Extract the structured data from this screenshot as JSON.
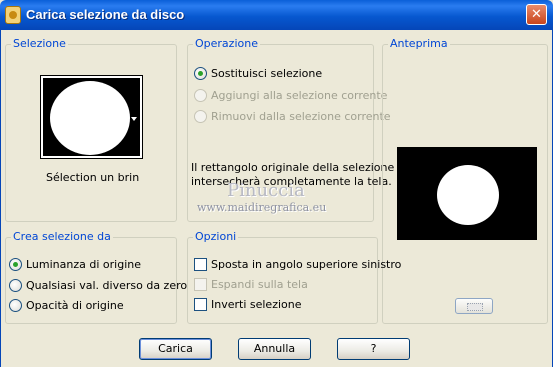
{
  "window": {
    "title": "Carica selezione da disco",
    "close_glyph": "✕"
  },
  "selezione": {
    "legend": "Selezione",
    "selection_name": "Sélection un brin"
  },
  "operazione": {
    "legend": "Operazione",
    "options": [
      {
        "label": "Sostituisci selezione",
        "checked": true,
        "enabled": true
      },
      {
        "label": "Aggiungi alla selezione corrente",
        "checked": false,
        "enabled": false
      },
      {
        "label": "Rimuovi dalla selezione corrente",
        "checked": false,
        "enabled": false
      }
    ],
    "info_line1": "Il rettangolo originale della selezione",
    "info_line2": "intersecherà completamente la tela."
  },
  "anteprima": {
    "legend": "Anteprima"
  },
  "crea_selezione": {
    "legend": "Crea selezione da",
    "options": [
      {
        "label": "Luminanza di origine",
        "checked": true
      },
      {
        "label": "Qualsiasi val. diverso da zero",
        "checked": false
      },
      {
        "label": "Opacità di origine",
        "checked": false
      }
    ]
  },
  "opzioni": {
    "legend": "Opzioni",
    "items": [
      {
        "label": "Sposta in angolo superiore sinistro",
        "checked": false,
        "enabled": true
      },
      {
        "label": "Espandi sulla tela",
        "checked": false,
        "enabled": false
      },
      {
        "label": "Inverti selezione",
        "checked": false,
        "enabled": true
      }
    ]
  },
  "watermark": {
    "name": "Pinuccia",
    "url": "www.maidiregrafica.eu"
  },
  "buttons": {
    "carica": "Carica",
    "annulla": "Annulla",
    "help": "?"
  },
  "colors": {
    "titlebar": "#0758d0",
    "legend": "#0046d5",
    "dialog_bg": "#ece9d8"
  },
  "icons": {
    "title": "load-selection-app-icon",
    "close": "close-icon"
  }
}
